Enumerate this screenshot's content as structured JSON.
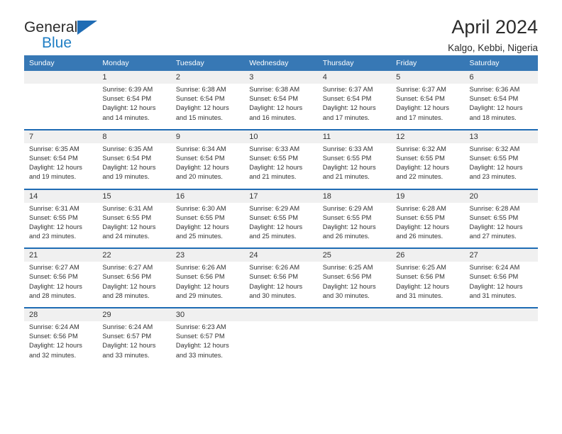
{
  "logo": {
    "word_general": "General",
    "word_blue": "Blue",
    "triangle_color": "#1f6cb4",
    "blue_color": "#1f7ec4"
  },
  "header": {
    "title": "April 2024",
    "subtitle": "Kalgo, Kebbi, Nigeria"
  },
  "theme": {
    "header_bg": "#3778b5",
    "divider": "#1f6cb4",
    "daynum_bg": "#f0f0f0",
    "text": "#333333"
  },
  "weekday_headers": [
    "Sunday",
    "Monday",
    "Tuesday",
    "Wednesday",
    "Thursday",
    "Friday",
    "Saturday"
  ],
  "weeks": [
    {
      "days": [
        {
          "num": "",
          "sunrise": "",
          "sunset": "",
          "daylight_line1": "",
          "daylight_line2": ""
        },
        {
          "num": "1",
          "sunrise": "Sunrise: 6:39 AM",
          "sunset": "Sunset: 6:54 PM",
          "daylight_line1": "Daylight: 12 hours",
          "daylight_line2": "and 14 minutes."
        },
        {
          "num": "2",
          "sunrise": "Sunrise: 6:38 AM",
          "sunset": "Sunset: 6:54 PM",
          "daylight_line1": "Daylight: 12 hours",
          "daylight_line2": "and 15 minutes."
        },
        {
          "num": "3",
          "sunrise": "Sunrise: 6:38 AM",
          "sunset": "Sunset: 6:54 PM",
          "daylight_line1": "Daylight: 12 hours",
          "daylight_line2": "and 16 minutes."
        },
        {
          "num": "4",
          "sunrise": "Sunrise: 6:37 AM",
          "sunset": "Sunset: 6:54 PM",
          "daylight_line1": "Daylight: 12 hours",
          "daylight_line2": "and 17 minutes."
        },
        {
          "num": "5",
          "sunrise": "Sunrise: 6:37 AM",
          "sunset": "Sunset: 6:54 PM",
          "daylight_line1": "Daylight: 12 hours",
          "daylight_line2": "and 17 minutes."
        },
        {
          "num": "6",
          "sunrise": "Sunrise: 6:36 AM",
          "sunset": "Sunset: 6:54 PM",
          "daylight_line1": "Daylight: 12 hours",
          "daylight_line2": "and 18 minutes."
        }
      ]
    },
    {
      "days": [
        {
          "num": "7",
          "sunrise": "Sunrise: 6:35 AM",
          "sunset": "Sunset: 6:54 PM",
          "daylight_line1": "Daylight: 12 hours",
          "daylight_line2": "and 19 minutes."
        },
        {
          "num": "8",
          "sunrise": "Sunrise: 6:35 AM",
          "sunset": "Sunset: 6:54 PM",
          "daylight_line1": "Daylight: 12 hours",
          "daylight_line2": "and 19 minutes."
        },
        {
          "num": "9",
          "sunrise": "Sunrise: 6:34 AM",
          "sunset": "Sunset: 6:54 PM",
          "daylight_line1": "Daylight: 12 hours",
          "daylight_line2": "and 20 minutes."
        },
        {
          "num": "10",
          "sunrise": "Sunrise: 6:33 AM",
          "sunset": "Sunset: 6:55 PM",
          "daylight_line1": "Daylight: 12 hours",
          "daylight_line2": "and 21 minutes."
        },
        {
          "num": "11",
          "sunrise": "Sunrise: 6:33 AM",
          "sunset": "Sunset: 6:55 PM",
          "daylight_line1": "Daylight: 12 hours",
          "daylight_line2": "and 21 minutes."
        },
        {
          "num": "12",
          "sunrise": "Sunrise: 6:32 AM",
          "sunset": "Sunset: 6:55 PM",
          "daylight_line1": "Daylight: 12 hours",
          "daylight_line2": "and 22 minutes."
        },
        {
          "num": "13",
          "sunrise": "Sunrise: 6:32 AM",
          "sunset": "Sunset: 6:55 PM",
          "daylight_line1": "Daylight: 12 hours",
          "daylight_line2": "and 23 minutes."
        }
      ]
    },
    {
      "days": [
        {
          "num": "14",
          "sunrise": "Sunrise: 6:31 AM",
          "sunset": "Sunset: 6:55 PM",
          "daylight_line1": "Daylight: 12 hours",
          "daylight_line2": "and 23 minutes."
        },
        {
          "num": "15",
          "sunrise": "Sunrise: 6:31 AM",
          "sunset": "Sunset: 6:55 PM",
          "daylight_line1": "Daylight: 12 hours",
          "daylight_line2": "and 24 minutes."
        },
        {
          "num": "16",
          "sunrise": "Sunrise: 6:30 AM",
          "sunset": "Sunset: 6:55 PM",
          "daylight_line1": "Daylight: 12 hours",
          "daylight_line2": "and 25 minutes."
        },
        {
          "num": "17",
          "sunrise": "Sunrise: 6:29 AM",
          "sunset": "Sunset: 6:55 PM",
          "daylight_line1": "Daylight: 12 hours",
          "daylight_line2": "and 25 minutes."
        },
        {
          "num": "18",
          "sunrise": "Sunrise: 6:29 AM",
          "sunset": "Sunset: 6:55 PM",
          "daylight_line1": "Daylight: 12 hours",
          "daylight_line2": "and 26 minutes."
        },
        {
          "num": "19",
          "sunrise": "Sunrise: 6:28 AM",
          "sunset": "Sunset: 6:55 PM",
          "daylight_line1": "Daylight: 12 hours",
          "daylight_line2": "and 26 minutes."
        },
        {
          "num": "20",
          "sunrise": "Sunrise: 6:28 AM",
          "sunset": "Sunset: 6:55 PM",
          "daylight_line1": "Daylight: 12 hours",
          "daylight_line2": "and 27 minutes."
        }
      ]
    },
    {
      "days": [
        {
          "num": "21",
          "sunrise": "Sunrise: 6:27 AM",
          "sunset": "Sunset: 6:56 PM",
          "daylight_line1": "Daylight: 12 hours",
          "daylight_line2": "and 28 minutes."
        },
        {
          "num": "22",
          "sunrise": "Sunrise: 6:27 AM",
          "sunset": "Sunset: 6:56 PM",
          "daylight_line1": "Daylight: 12 hours",
          "daylight_line2": "and 28 minutes."
        },
        {
          "num": "23",
          "sunrise": "Sunrise: 6:26 AM",
          "sunset": "Sunset: 6:56 PM",
          "daylight_line1": "Daylight: 12 hours",
          "daylight_line2": "and 29 minutes."
        },
        {
          "num": "24",
          "sunrise": "Sunrise: 6:26 AM",
          "sunset": "Sunset: 6:56 PM",
          "daylight_line1": "Daylight: 12 hours",
          "daylight_line2": "and 30 minutes."
        },
        {
          "num": "25",
          "sunrise": "Sunrise: 6:25 AM",
          "sunset": "Sunset: 6:56 PM",
          "daylight_line1": "Daylight: 12 hours",
          "daylight_line2": "and 30 minutes."
        },
        {
          "num": "26",
          "sunrise": "Sunrise: 6:25 AM",
          "sunset": "Sunset: 6:56 PM",
          "daylight_line1": "Daylight: 12 hours",
          "daylight_line2": "and 31 minutes."
        },
        {
          "num": "27",
          "sunrise": "Sunrise: 6:24 AM",
          "sunset": "Sunset: 6:56 PM",
          "daylight_line1": "Daylight: 12 hours",
          "daylight_line2": "and 31 minutes."
        }
      ]
    },
    {
      "days": [
        {
          "num": "28",
          "sunrise": "Sunrise: 6:24 AM",
          "sunset": "Sunset: 6:56 PM",
          "daylight_line1": "Daylight: 12 hours",
          "daylight_line2": "and 32 minutes."
        },
        {
          "num": "29",
          "sunrise": "Sunrise: 6:24 AM",
          "sunset": "Sunset: 6:57 PM",
          "daylight_line1": "Daylight: 12 hours",
          "daylight_line2": "and 33 minutes."
        },
        {
          "num": "30",
          "sunrise": "Sunrise: 6:23 AM",
          "sunset": "Sunset: 6:57 PM",
          "daylight_line1": "Daylight: 12 hours",
          "daylight_line2": "and 33 minutes."
        },
        {
          "num": "",
          "sunrise": "",
          "sunset": "",
          "daylight_line1": "",
          "daylight_line2": ""
        },
        {
          "num": "",
          "sunrise": "",
          "sunset": "",
          "daylight_line1": "",
          "daylight_line2": ""
        },
        {
          "num": "",
          "sunrise": "",
          "sunset": "",
          "daylight_line1": "",
          "daylight_line2": ""
        },
        {
          "num": "",
          "sunrise": "",
          "sunset": "",
          "daylight_line1": "",
          "daylight_line2": ""
        }
      ]
    }
  ]
}
